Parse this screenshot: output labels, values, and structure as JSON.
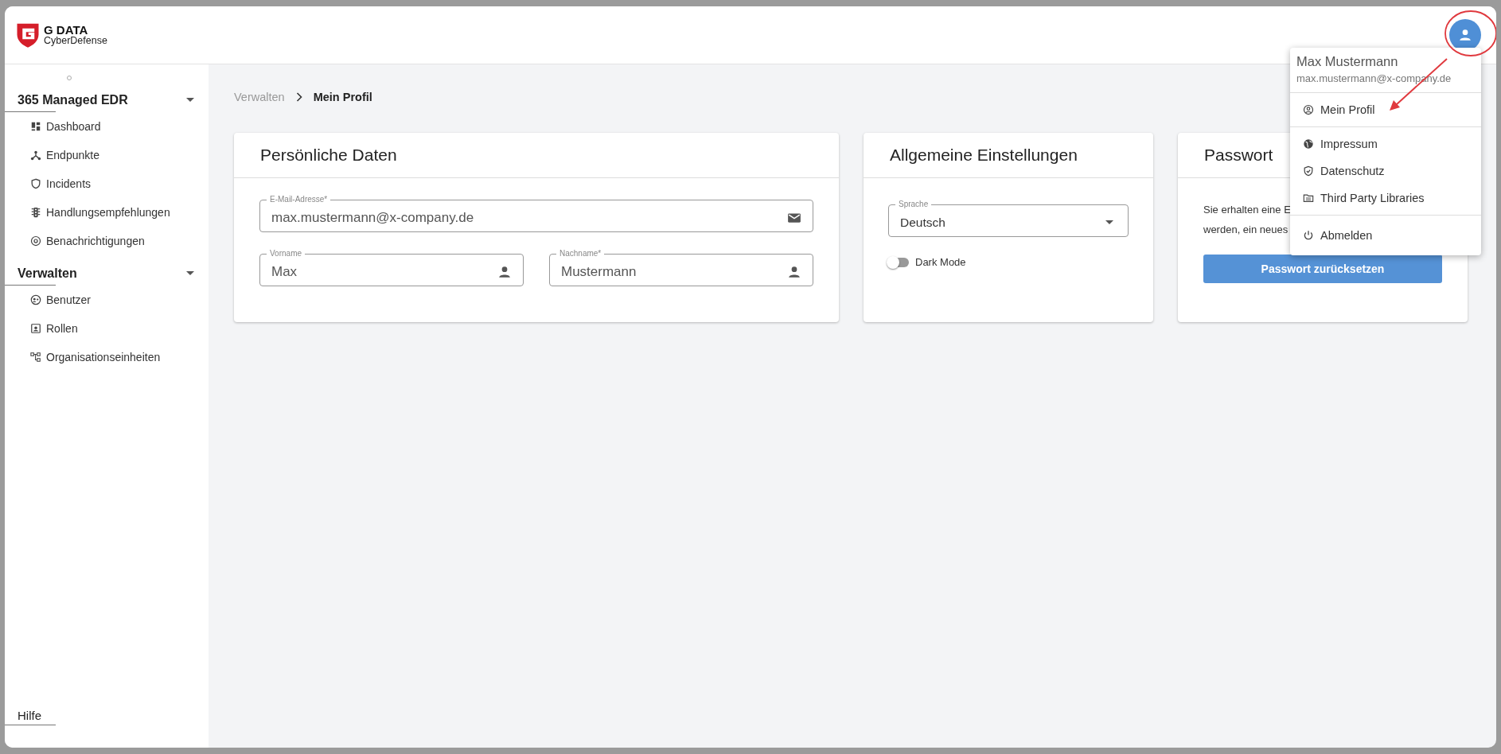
{
  "header": {
    "brand": "G DATA",
    "tagline": "CyberDefense"
  },
  "sidebar": {
    "sections": [
      {
        "title": "365 Managed EDR",
        "expanded": true,
        "items": [
          {
            "label": "Dashboard"
          },
          {
            "label": "Endpunkte"
          },
          {
            "label": "Incidents"
          },
          {
            "label": "Handlungsempfehlungen"
          },
          {
            "label": "Benachrichtigungen"
          }
        ]
      },
      {
        "title": "Verwalten",
        "expanded": true,
        "items": [
          {
            "label": "Benutzer"
          },
          {
            "label": "Rollen"
          },
          {
            "label": "Organisationseinheiten"
          }
        ]
      }
    ],
    "footer": "Hilfe"
  },
  "breadcrumb": [
    {
      "label": "Verwalten",
      "current": false
    },
    {
      "label": "Mein Profil",
      "current": true
    }
  ],
  "cards": [
    {
      "kind": "personal",
      "title": "Persönliche Daten",
      "fields": [
        {
          "label": "E-Mail-Adresse*",
          "value": "max.mustermann@x-company.de"
        },
        {
          "label": "Vorname",
          "value": "Max"
        },
        {
          "label": "Nachname*",
          "value": "Mustermann"
        }
      ]
    },
    {
      "kind": "settings",
      "title": "Allgemeine Einstellungen",
      "select": {
        "label": "Sprache",
        "value": "Deutsch"
      },
      "toggle": {
        "label": "Dark Mode",
        "on": false
      }
    },
    {
      "kind": "password",
      "title": "Passwort",
      "lines": [
        "Sie erhalten eine E",
        "werden, ein neues"
      ],
      "button": "Passwort zurücksetzen"
    }
  ],
  "user_menu": {
    "name": "Max Mustermann",
    "email": "max.mustermann@x-company.de",
    "groups": [
      [
        {
          "label": "Mein Profil"
        }
      ],
      [
        {
          "label": "Impressum"
        },
        {
          "label": "Datenschutz"
        },
        {
          "label": "Third Party Libraries"
        }
      ],
      [
        {
          "label": "Abmelden"
        }
      ]
    ]
  }
}
